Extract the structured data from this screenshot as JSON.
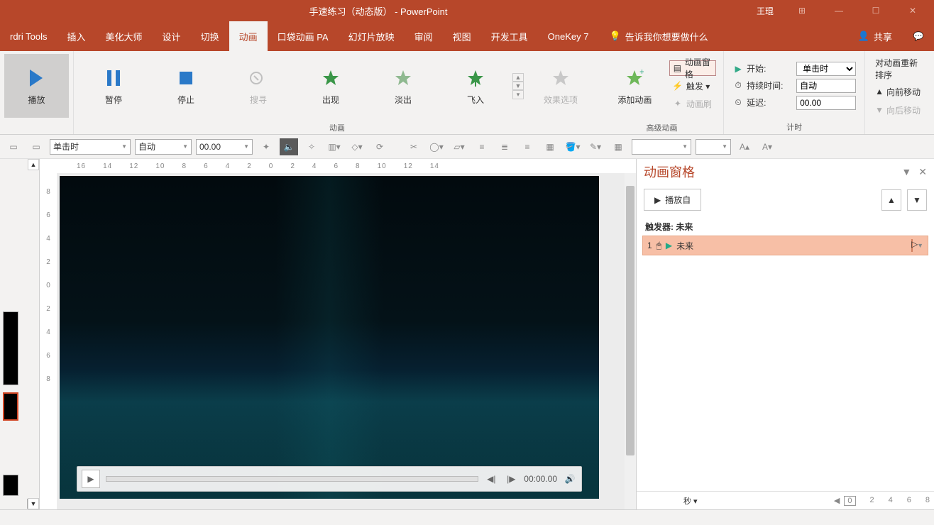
{
  "title": "手速练习（动态版） - PowerPoint",
  "username": "王琨",
  "tabs": [
    "rdri Tools",
    "插入",
    "美化大师",
    "设计",
    "切换",
    "动画",
    "口袋动画 PA",
    "幻灯片放映",
    "审阅",
    "视图",
    "开发工具",
    "OneKey 7"
  ],
  "active_tab": "动画",
  "tell_me": "告诉我你想要做什么",
  "share": "共享",
  "ribbon": {
    "preview": {
      "play": "播放",
      "pause": "暂停",
      "stop": "停止",
      "seek": "搜寻"
    },
    "anim_group": "动画",
    "effects": {
      "appear": "出现",
      "fade": "淡出",
      "flyin": "飞入"
    },
    "effect_options": "效果选项",
    "advanced": {
      "label": "高级动画",
      "add": "添加动画",
      "pane": "动画窗格",
      "trigger": "触发 ▾",
      "painter": "动画刷"
    },
    "timing": {
      "label": "计时",
      "start": "开始:",
      "start_val": "单击时",
      "duration": "持续时间:",
      "duration_val": "自动",
      "delay": "延迟:",
      "delay_val": "00.00"
    },
    "reorder": {
      "label": "对动画重新排序",
      "fwd": "向前移动",
      "back": "向后移动"
    }
  },
  "toolbar2": {
    "start": "单击时",
    "dur": "自动",
    "delay": "00.00"
  },
  "ruler_h": [
    "16",
    "14",
    "12",
    "10",
    "8",
    "6",
    "4",
    "2",
    "0",
    "2",
    "4",
    "6",
    "8",
    "10",
    "12",
    "14"
  ],
  "ruler_v": [
    "8",
    "6",
    "4",
    "2",
    "0",
    "2",
    "4",
    "6",
    "8"
  ],
  "video": {
    "time": "00:00.00"
  },
  "anim_pane": {
    "title": "动画窗格",
    "play_from": "播放自",
    "trigger_label": "触发器: 未来",
    "item": {
      "num": "1",
      "name": "未来"
    },
    "seconds": "秒 ▾",
    "ticks": [
      "0",
      "2",
      "4",
      "6",
      "8"
    ]
  }
}
